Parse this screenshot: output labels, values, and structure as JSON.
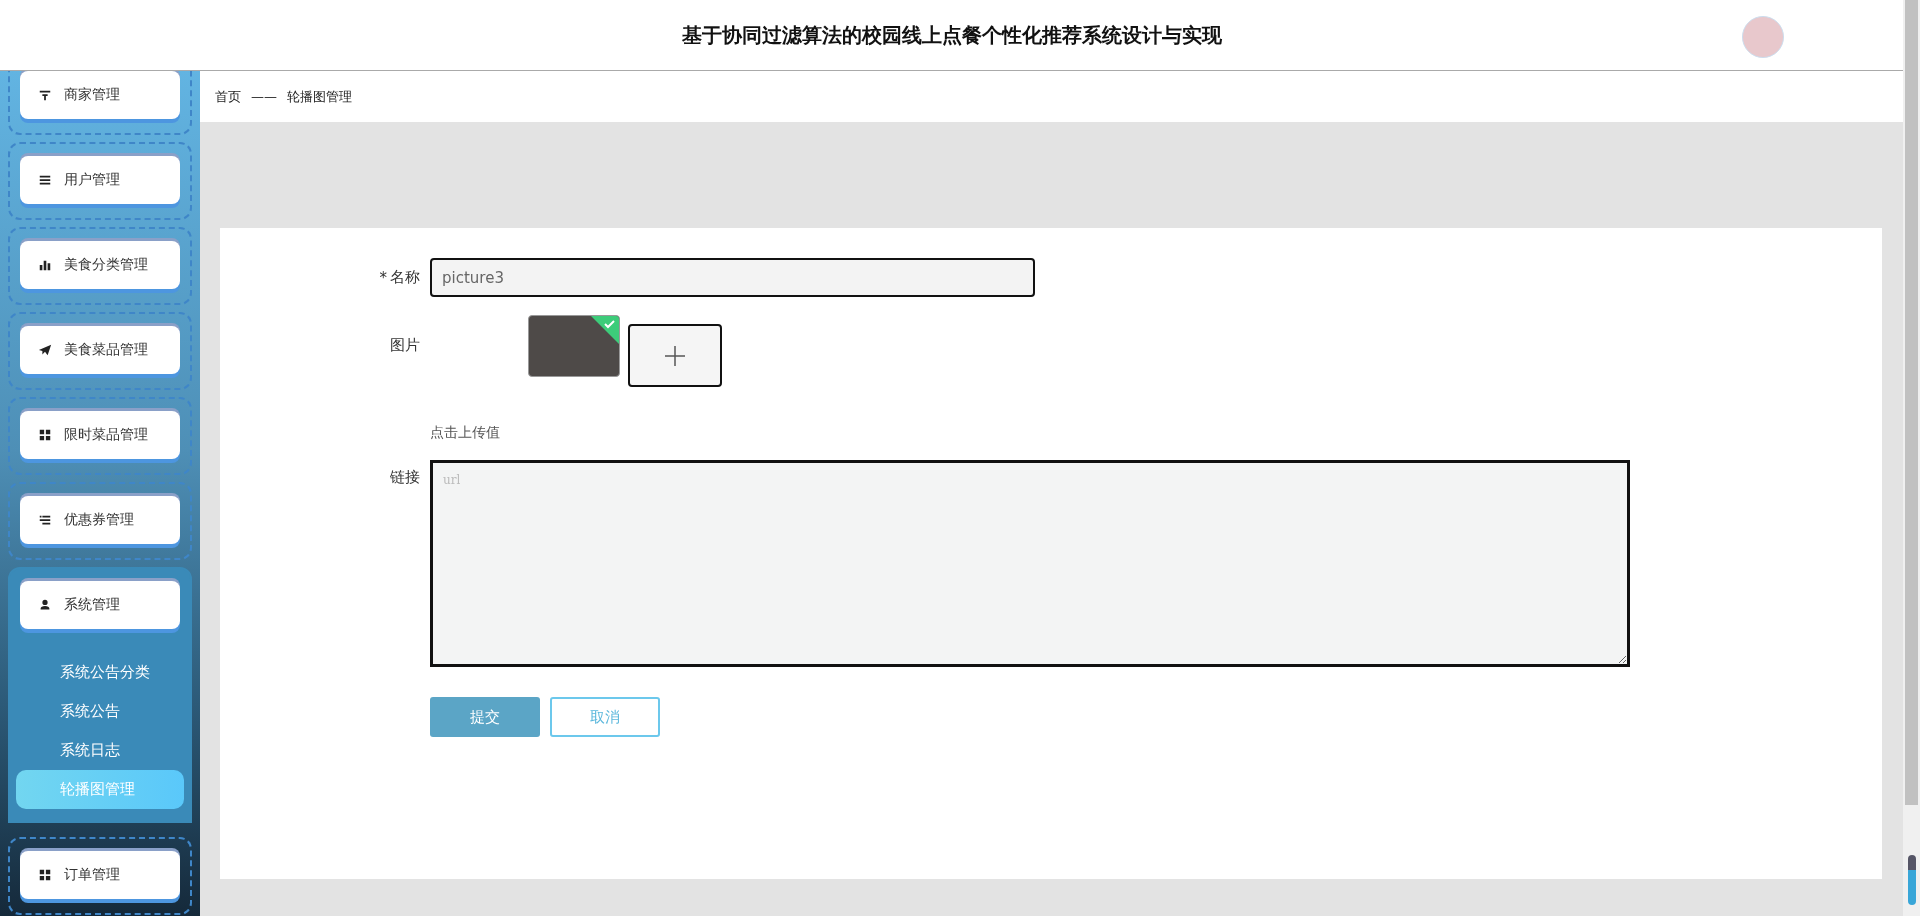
{
  "header": {
    "title": "基于协同过滤算法的校园线上点餐个性化推荐系统设计与实现"
  },
  "sidebar": {
    "items": [
      {
        "label": "商家管理"
      },
      {
        "label": "用户管理"
      },
      {
        "label": "美食分类管理"
      },
      {
        "label": "美食菜品管理"
      },
      {
        "label": "限时菜品管理"
      },
      {
        "label": "优惠券管理"
      },
      {
        "label": "系统管理",
        "children": [
          {
            "label": "系统公告分类",
            "selected": false
          },
          {
            "label": "系统公告",
            "selected": false
          },
          {
            "label": "系统日志",
            "selected": false
          },
          {
            "label": "轮播图管理",
            "selected": true
          }
        ]
      },
      {
        "label": "订单管理"
      }
    ]
  },
  "breadcrumb": {
    "items": [
      "首页",
      "轮播图管理"
    ],
    "separator": "——"
  },
  "form": {
    "fields": [
      {
        "kind": "text",
        "label": "名称",
        "required_mark": "*",
        "value": "picture3"
      },
      {
        "kind": "image",
        "label": "图片",
        "hint": "点击上传值"
      },
      {
        "kind": "textarea",
        "label": "链接",
        "placeholder": "url"
      }
    ],
    "buttons": [
      {
        "kind": "primary",
        "label": "提交"
      },
      {
        "kind": "secondary",
        "label": "取消"
      }
    ]
  }
}
